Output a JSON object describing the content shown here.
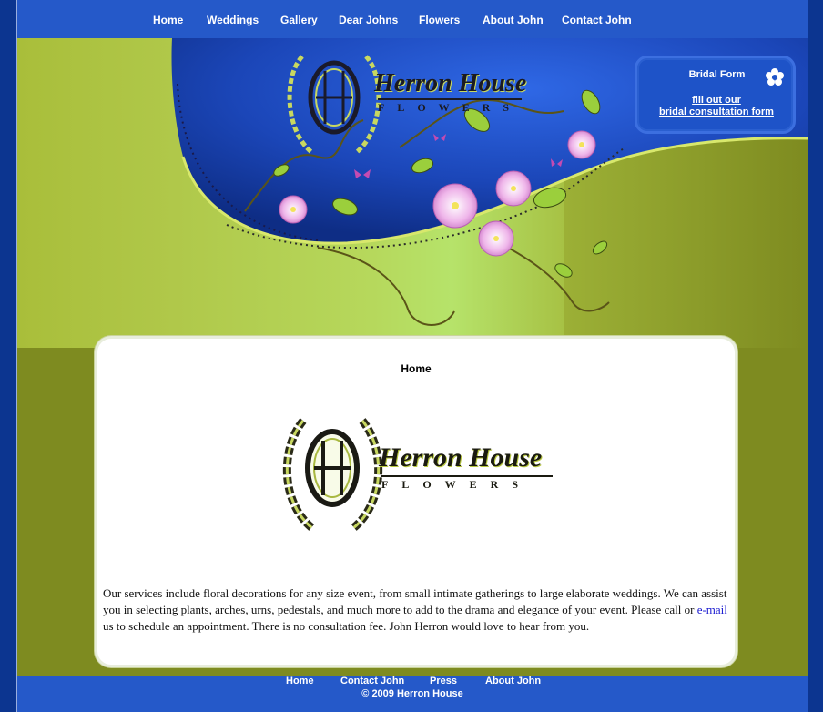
{
  "nav": {
    "items": [
      {
        "label": "Home"
      },
      {
        "label": "Weddings"
      },
      {
        "label": "Gallery"
      },
      {
        "label": "Dear Johns"
      },
      {
        "label": "Flowers"
      },
      {
        "label": "About John"
      },
      {
        "label": "Contact John"
      }
    ]
  },
  "logo": {
    "name": "Herron House",
    "tagline": "FLOWERS"
  },
  "bridal": {
    "title": "Bridal Form",
    "link_line1": "fill out our",
    "link_line2": "bridal consultation form",
    "icon": "flower-icon"
  },
  "main": {
    "title": "Home",
    "intro_before": "Our services include floral decorations for any size event, from small intimate gatherings to large elaborate weddings. We can assist you in selecting plants, arches, urns, pedestals, and much more to add to the drama and elegance of your event. Please call or ",
    "email_link": "e-mail",
    "intro_after": " us to schedule an appointment. There is no consultation fee. John Herron would love to hear from you."
  },
  "footer": {
    "items": [
      {
        "label": "Home"
      },
      {
        "label": "Contact John"
      },
      {
        "label": "Press"
      },
      {
        "label": "About John"
      }
    ],
    "copyright": "© 2009 Herron House"
  },
  "colors": {
    "nav_blue": "#2559c9",
    "page_bg": "#0c3590",
    "olive": "#7e8b20",
    "lime": "#b6e36a",
    "blossom": "#e8a6e0"
  }
}
